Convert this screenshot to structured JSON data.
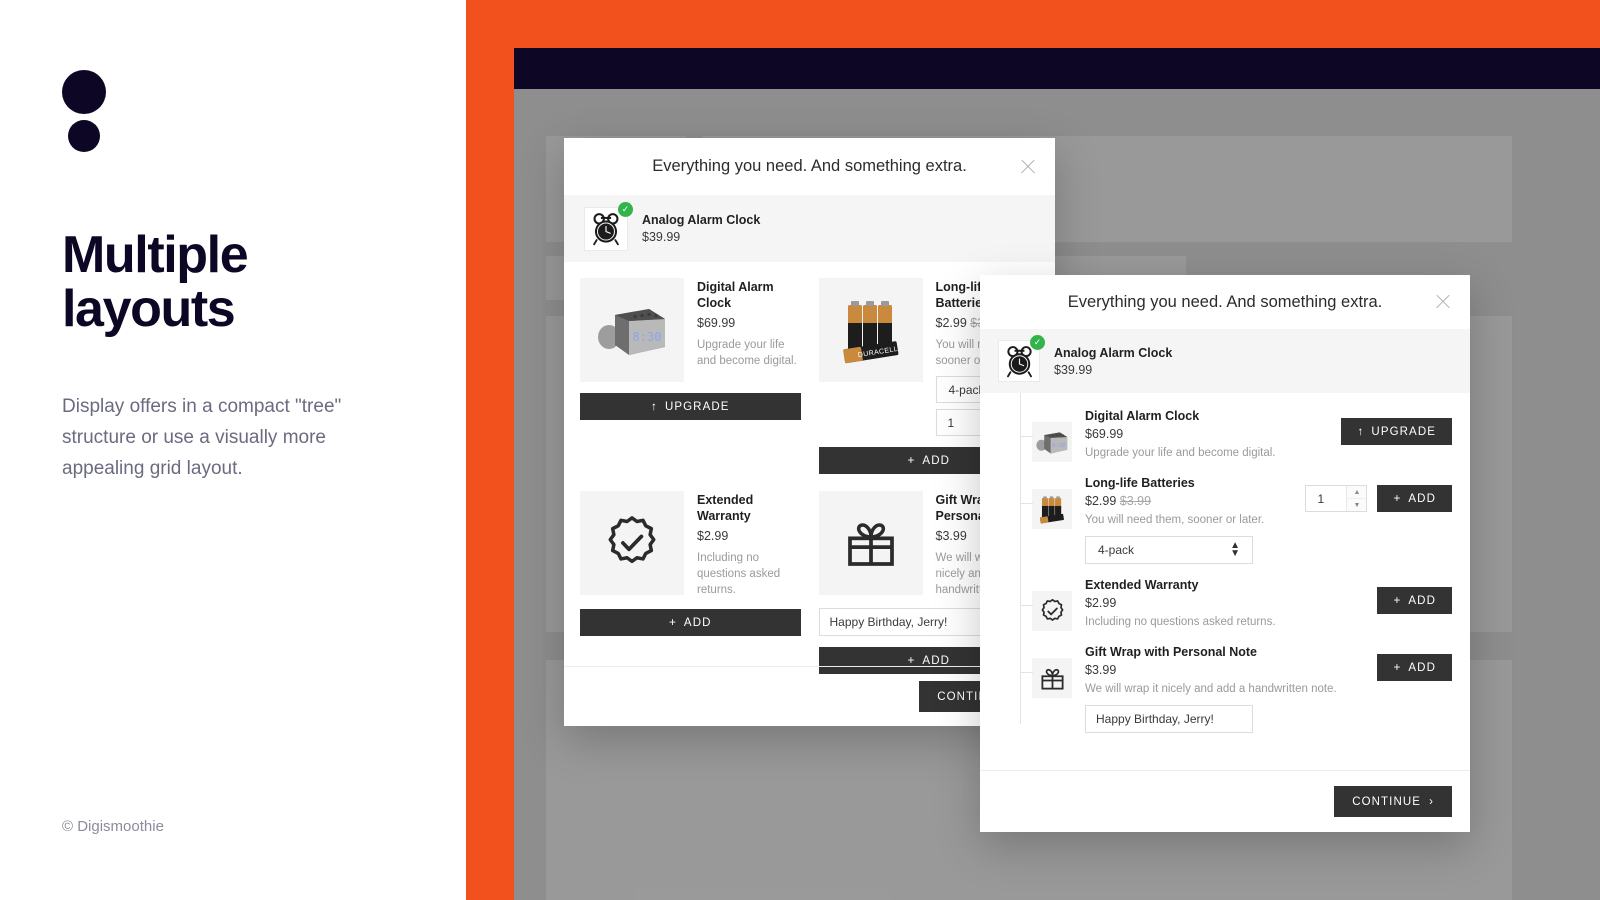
{
  "brand": {
    "logo_name": "digismoothie-dots-logo",
    "headline": "Multiple layouts",
    "subcopy": "Display offers in a compact \"tree\" structure or use a visually more appealing grid layout.",
    "copyright": "© Digismoothie",
    "colors": {
      "accent_orange": "#F2511E",
      "ink_navy": "#0D0725",
      "button_dark": "#333333",
      "check_green": "#33B44A",
      "muted_text": "#9A9A9A"
    }
  },
  "modal_grid": {
    "title": "Everything you need. And something extra.",
    "close_label": "×",
    "base_product": {
      "name": "Analog Alarm Clock",
      "price": "$39.99",
      "image": "analog-alarm-clock",
      "selected_badge": "✓"
    },
    "offers": [
      {
        "name": "Digital Alarm Clock",
        "price": "$69.99",
        "old_price": "",
        "description": "Upgrade your life and become digital.",
        "image": "digital-alarm-clock",
        "button": "UPGRADE",
        "button_glyph": "↑"
      },
      {
        "name": "Long-life Batteries",
        "price": "$2.99",
        "old_price": "$3.99",
        "description": "You will need them, sooner or later.",
        "image": "duracell-batteries",
        "variant": "4-pack",
        "quantity": "1",
        "button": "ADD",
        "button_glyph": "+"
      },
      {
        "name": "Extended Warranty",
        "price": "$2.99",
        "old_price": "",
        "description": "Including no questions asked returns.",
        "image": "warranty-seal-icon",
        "button": "ADD",
        "button_glyph": "+"
      },
      {
        "name": "Gift Wrap with Personal Note",
        "price": "$3.99",
        "old_price": "",
        "description": "We will wrap it nicely and add a handwritten note.",
        "image": "gift-icon",
        "note_value": "Happy Birthday, Jerry!",
        "button": "ADD",
        "button_glyph": "+"
      }
    ],
    "footer_button": "CONTINUE",
    "footer_glyph": "›"
  },
  "modal_tree": {
    "title": "Everything you need. And something extra.",
    "close_label": "×",
    "base_product": {
      "name": "Analog Alarm Clock",
      "price": "$39.99",
      "image": "analog-alarm-clock",
      "selected_badge": "✓"
    },
    "offers": [
      {
        "name": "Digital Alarm Clock",
        "price": "$69.99",
        "old_price": "",
        "description": "Upgrade your life and become digital.",
        "image": "digital-alarm-clock",
        "button": "UPGRADE",
        "button_glyph": "↑"
      },
      {
        "name": "Long-life Batteries",
        "price": "$2.99",
        "old_price": "$3.99",
        "description": "You will need them, sooner or later.",
        "image": "duracell-batteries",
        "variant": "4-pack",
        "quantity": "1",
        "button": "ADD",
        "button_glyph": "+"
      },
      {
        "name": "Extended Warranty",
        "price": "$2.99",
        "old_price": "",
        "description": "Including no questions asked returns.",
        "image": "warranty-seal-icon",
        "button": "ADD",
        "button_glyph": "+"
      },
      {
        "name": "Gift Wrap with Personal Note",
        "price": "$3.99",
        "old_price": "",
        "description": "We will wrap it nicely and add a handwritten note.",
        "image": "gift-icon",
        "note_value": "Happy Birthday, Jerry!",
        "button": "ADD",
        "button_glyph": "+"
      }
    ],
    "footer_button": "CONTINUE",
    "footer_glyph": "›"
  }
}
